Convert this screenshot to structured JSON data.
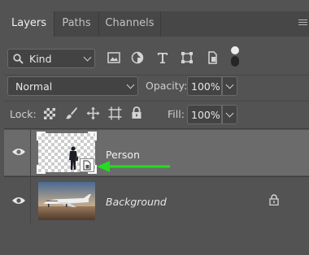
{
  "tabs": [
    {
      "label": "Layers"
    },
    {
      "label": "Paths"
    },
    {
      "label": "Channels"
    }
  ],
  "filter": {
    "kind_label": "Kind",
    "icons": [
      "image-filter-icon",
      "adjustment-filter-icon",
      "type-filter-icon",
      "shape-filter-icon",
      "smart-object-filter-icon",
      "filter-toggle-icon"
    ]
  },
  "blend": {
    "mode": "Normal",
    "opacity_label": "Opacity:",
    "opacity_value": "100%"
  },
  "lock": {
    "label": "Lock:",
    "fill_label": "Fill:",
    "fill_value": "100%"
  },
  "layers": [
    {
      "name": "Person",
      "visible": true,
      "selected": true,
      "smart_object": true
    },
    {
      "name": "Background",
      "visible": true,
      "locked": true
    }
  ],
  "annotation": {
    "arrow_color": "#22dd22"
  }
}
